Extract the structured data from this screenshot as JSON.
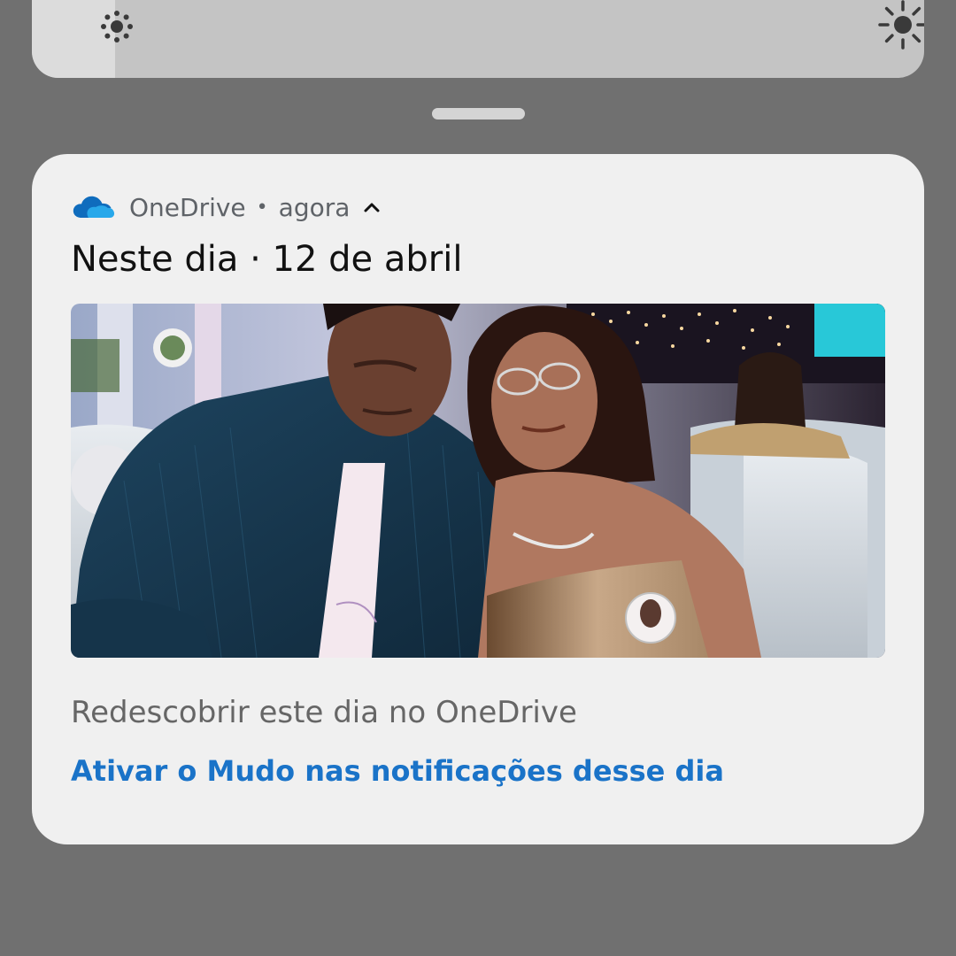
{
  "quick_settings": {
    "brightness_slider": {
      "level": 0.09
    },
    "icons": [
      "brightness-low-icon",
      "brightness-high-icon"
    ]
  },
  "notification": {
    "app_name": "OneDrive",
    "separator": "•",
    "time": "agora",
    "title": "Neste dia · 12 de abril",
    "photo_icon": "onedrive-cloud-icon",
    "body": "Redescobrir este dia no OneDrive",
    "action_label": "Ativar o Mudo nas notificações desse dia",
    "action_color": "#1a73c8"
  },
  "colors": {
    "background": "#707070",
    "card": "#f0f0f0",
    "onedrive_blue": "#0f6cbd"
  }
}
